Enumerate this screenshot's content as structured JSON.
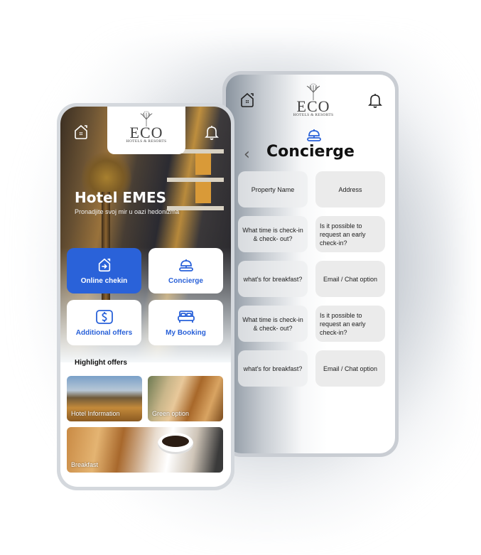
{
  "brand": {
    "logo_text": "ECO",
    "logo_subtitle": "HOTELS & RESORTS",
    "accent_color": "#2a62d9"
  },
  "home_screen": {
    "hotel_name": "Hotel EMES",
    "tagline": "Pronadjite svoj mir u oazi hedonizma",
    "icons": {
      "left": "home-icon",
      "right": "bell-icon"
    },
    "tiles": [
      {
        "label": "Online chekin",
        "icon": "home-arrow-icon",
        "active": true
      },
      {
        "label": "Concierge",
        "icon": "concierge-bell-icon",
        "active": false
      },
      {
        "label": "Additional offers",
        "icon": "dollar-icon",
        "active": false
      },
      {
        "label": "My Booking",
        "icon": "bed-icon",
        "active": false
      }
    ],
    "highlight_title": "Highlight offers",
    "offers": [
      {
        "label": "Hotel Information"
      },
      {
        "label": "Green option"
      },
      {
        "label": "Breakfast"
      }
    ]
  },
  "concierge_screen": {
    "title": "Concierge",
    "back_icon": "chevron-left-icon",
    "questions": [
      {
        "text": "Property Name"
      },
      {
        "text": "Address"
      },
      {
        "text": "What time is check-in & check- out?"
      },
      {
        "text": "Is it possible to request an early check-in?"
      },
      {
        "text": "what's for breakfast?"
      },
      {
        "text": "Email / Chat option"
      },
      {
        "text": "What time is check-in & check- out?"
      },
      {
        "text": "Is it possible to request an early check-in?"
      },
      {
        "text": "what's for breakfast?"
      },
      {
        "text": "Email / Chat option"
      }
    ]
  }
}
